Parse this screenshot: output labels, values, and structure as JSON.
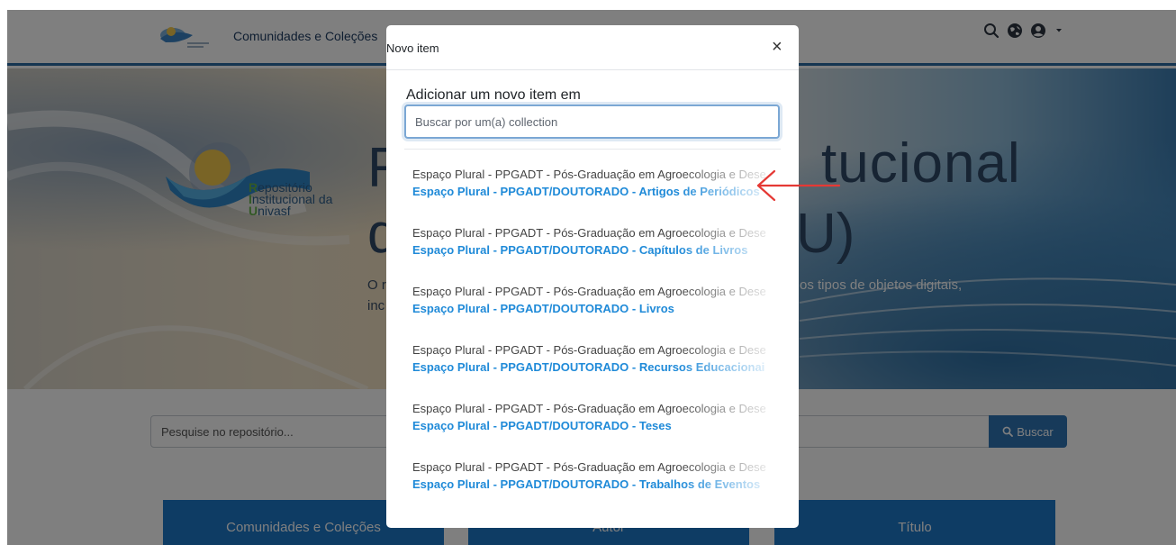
{
  "navbar": {
    "link": "Comunidades e Coleções",
    "icons": [
      "search-icon",
      "globe-icon",
      "user-icon",
      "caret-down-icon"
    ]
  },
  "banner": {
    "title_left": "R",
    "title_right": "tucional",
    "title_left2": "d",
    "title_right2": "U)",
    "subtitle_left": "O r",
    "subtitle_left2": "inc",
    "subtitle_right": "os tipos de objetos digitais,",
    "brand": {
      "line1_cap": "R",
      "line1": "epositório",
      "line2_cap": "I",
      "line2": "nstitucional da",
      "line3_cap": "U",
      "line3": "nivasf"
    }
  },
  "search": {
    "placeholder": "Pesquise no repositório...",
    "button_label": "Buscar"
  },
  "tiles": [
    "Comunidades e Coleções",
    "Autor",
    "Título"
  ],
  "modal": {
    "title": "Novo item",
    "close": "×",
    "label": "Adicionar um novo item em",
    "search_placeholder": "Buscar por um(a) collection",
    "results": [
      {
        "community": "Espaço Plural - PPGADT - Pós-Graduação em Agroecologia e Desenvolvimento Territorial",
        "collection": "Espaço Plural - PPGADT/DOUTORADO - Artigos de Periódicos"
      },
      {
        "community": "Espaço Plural - PPGADT - Pós-Graduação em Agroecologia e Desenvolvimento Territorial",
        "collection": "Espaço Plural - PPGADT/DOUTORADO - Capítulos de Livros"
      },
      {
        "community": "Espaço Plural - PPGADT - Pós-Graduação em Agroecologia e Desenvolvimento Territorial",
        "collection": "Espaço Plural - PPGADT/DOUTORADO - Livros"
      },
      {
        "community": "Espaço Plural - PPGADT - Pós-Graduação em Agroecologia e Desenvolvimento Territorial",
        "collection": "Espaço Plural - PPGADT/DOUTORADO - Recursos Educacionais"
      },
      {
        "community": "Espaço Plural - PPGADT - Pós-Graduação em Agroecologia e Desenvolvimento Territorial",
        "collection": "Espaço Plural - PPGADT/DOUTORADO - Teses"
      },
      {
        "community": "Espaço Plural - PPGADT - Pós-Graduação em Agroecologia e Desenvolvimento Territorial",
        "collection": "Espaço Plural - PPGADT/DOUTORADO - Trabalhos de Eventos"
      }
    ]
  },
  "colors": {
    "accent": "#1f8ad8",
    "nav_border": "#2b6aa3",
    "button": "#2f74b5",
    "tile": "#1d78c9",
    "annotation_arrow": "#e53935"
  }
}
